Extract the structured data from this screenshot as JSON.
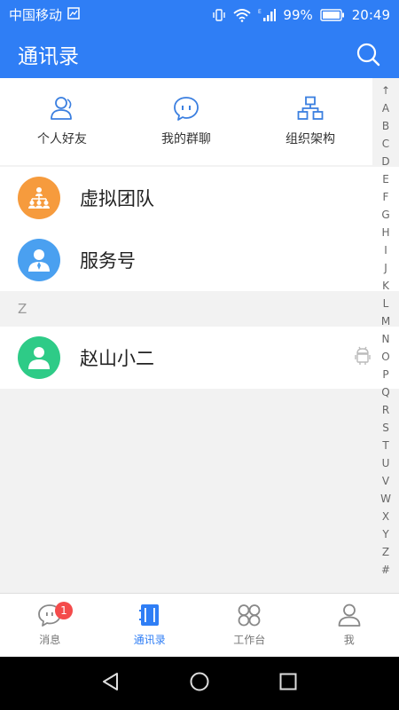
{
  "status_bar": {
    "carrier": "中国移动",
    "battery": "99%",
    "time": "20:49"
  },
  "header": {
    "title": "通讯录"
  },
  "quick_actions": [
    {
      "label": "个人好友",
      "icon": "person-friend-icon"
    },
    {
      "label": "我的群聊",
      "icon": "chat-group-icon"
    },
    {
      "label": "组织架构",
      "icon": "org-chart-icon"
    }
  ],
  "items": [
    {
      "label": "虚拟团队",
      "icon": "team-icon",
      "color": "#f69b3d"
    },
    {
      "label": "服务号",
      "icon": "service-person-icon",
      "color": "#4aa0f0"
    }
  ],
  "section": {
    "letter": "Z",
    "contacts": [
      {
        "label": "赵山小二",
        "icon": "person-icon",
        "color": "#2ecb87"
      }
    ]
  },
  "index_bar": [
    "↑",
    "A",
    "B",
    "C",
    "D",
    "E",
    "F",
    "G",
    "H",
    "I",
    "J",
    "K",
    "L",
    "M",
    "N",
    "O",
    "P",
    "Q",
    "R",
    "S",
    "T",
    "U",
    "V",
    "W",
    "X",
    "Y",
    "Z",
    "#"
  ],
  "bottom_nav": [
    {
      "label": "消息",
      "icon": "message-icon",
      "badge": "1"
    },
    {
      "label": "通讯录",
      "icon": "contacts-book-icon",
      "active": true
    },
    {
      "label": "工作台",
      "icon": "workbench-icon"
    },
    {
      "label": "我",
      "icon": "me-icon"
    }
  ],
  "colors": {
    "primary": "#2f7ef5",
    "badge": "#f44b4b"
  }
}
